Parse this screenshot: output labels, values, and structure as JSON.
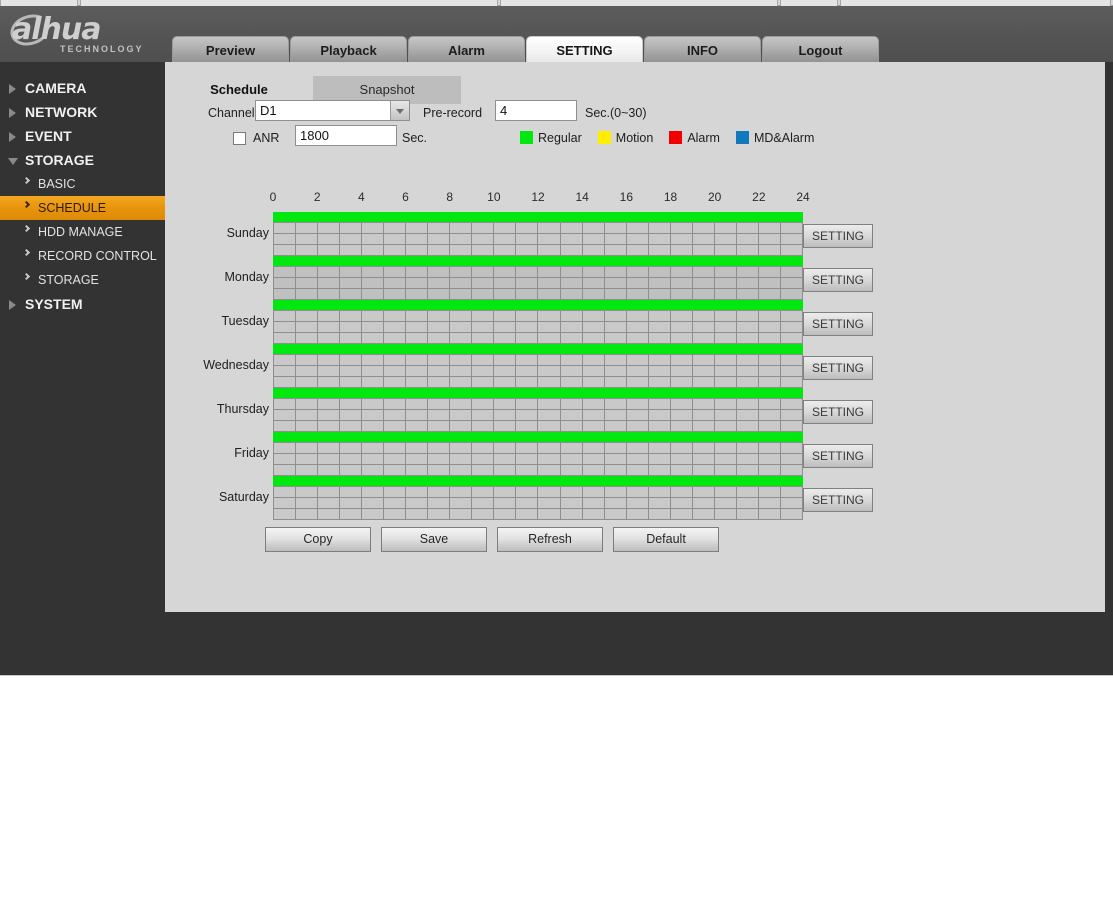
{
  "browser_strip": {
    "segments": [
      0,
      80,
      500,
      780,
      840
    ]
  },
  "header": {
    "logo_text": "alhua",
    "logo_tagline": "TECHNOLOGY",
    "nav_tabs": [
      {
        "label": "Preview",
        "active": false
      },
      {
        "label": "Playback",
        "active": false
      },
      {
        "label": "Alarm",
        "active": false
      },
      {
        "label": "SETTING",
        "active": true
      },
      {
        "label": "INFO",
        "active": false
      },
      {
        "label": "Logout",
        "active": false
      }
    ]
  },
  "sidebar": {
    "items": [
      {
        "label": "CAMERA",
        "type": "top",
        "open": false
      },
      {
        "label": "NETWORK",
        "type": "top",
        "open": false
      },
      {
        "label": "EVENT",
        "type": "top",
        "open": false
      },
      {
        "label": "STORAGE",
        "type": "top",
        "open": true
      },
      {
        "label": "BASIC",
        "type": "sub",
        "active": false
      },
      {
        "label": "SCHEDULE",
        "type": "sub",
        "active": true
      },
      {
        "label": "HDD MANAGE",
        "type": "sub",
        "active": false
      },
      {
        "label": "RECORD CONTROL",
        "type": "sub",
        "active": false
      },
      {
        "label": "STORAGE",
        "type": "sub",
        "active": false
      },
      {
        "label": "SYSTEM",
        "type": "top",
        "open": false
      }
    ]
  },
  "content": {
    "subtabs": [
      {
        "label": "Schedule",
        "active": true
      },
      {
        "label": "Snapshot",
        "active": false
      }
    ],
    "form": {
      "channel_label": "Channel",
      "channel_value": "D1",
      "prerecord_label": "Pre-record",
      "prerecord_value": "4",
      "prerecord_unit": "Sec.(0~30)",
      "anr_label": "ANR",
      "anr_checked": false,
      "anr_value": "1800",
      "anr_unit": "Sec."
    },
    "legend": [
      {
        "label": "Regular",
        "color": "#00e810"
      },
      {
        "label": "Motion",
        "color": "#ffee00"
      },
      {
        "label": "Alarm",
        "color": "#f00000"
      },
      {
        "label": "MD&Alarm",
        "color": "#1278bc"
      }
    ],
    "schedule": {
      "hour_ticks": [
        "0",
        "2",
        "4",
        "6",
        "8",
        "10",
        "12",
        "14",
        "16",
        "18",
        "20",
        "22",
        "24"
      ],
      "setting_label": "SETTING",
      "days": [
        {
          "name": "Sunday",
          "regular_start": 0,
          "regular_end": 24
        },
        {
          "name": "Monday",
          "regular_start": 0,
          "regular_end": 24
        },
        {
          "name": "Tuesday",
          "regular_start": 0,
          "regular_end": 24
        },
        {
          "name": "Wednesday",
          "regular_start": 0,
          "regular_end": 24
        },
        {
          "name": "Thursday",
          "regular_start": 0,
          "regular_end": 24
        },
        {
          "name": "Friday",
          "regular_start": 0,
          "regular_end": 24
        },
        {
          "name": "Saturday",
          "regular_start": 0,
          "regular_end": 24
        }
      ]
    },
    "actions": [
      {
        "label": "Copy"
      },
      {
        "label": "Save"
      },
      {
        "label": "Refresh"
      },
      {
        "label": "Default"
      }
    ]
  }
}
